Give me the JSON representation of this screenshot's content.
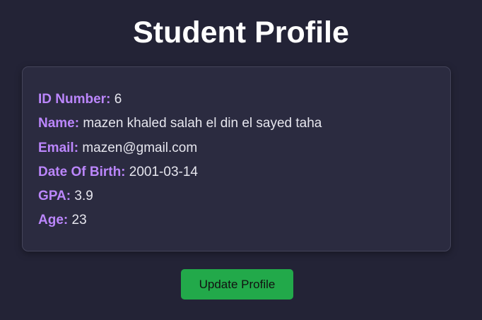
{
  "header": {
    "title": "Student Profile"
  },
  "profile": {
    "fields": [
      {
        "label": "ID Number:",
        "value": "6"
      },
      {
        "label": "Name:",
        "value": "mazen khaled salah el din el sayed taha"
      },
      {
        "label": "Email:",
        "value": "mazen@gmail.com"
      },
      {
        "label": "Date Of Birth:",
        "value": "2001-03-14"
      },
      {
        "label": "GPA:",
        "value": "3.9"
      },
      {
        "label": "Age:",
        "value": "23"
      }
    ]
  },
  "actions": {
    "update_label": "Update Profile"
  },
  "colors": {
    "background": "#232336",
    "card": "#2b2b40",
    "label_accent": "#bb86fc",
    "button": "#22a94a"
  }
}
